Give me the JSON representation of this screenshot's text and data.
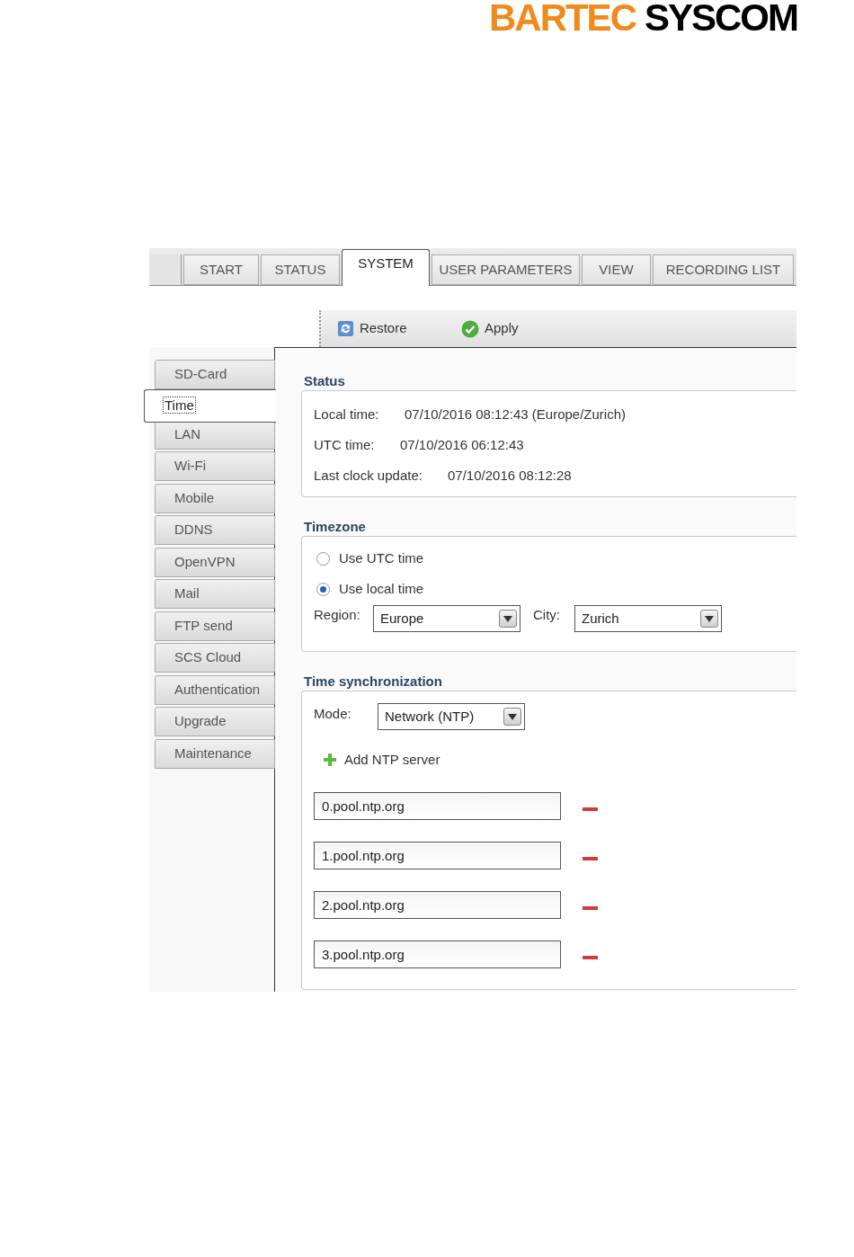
{
  "logo": {
    "brand": "BARTEC",
    "product": "SYSCOM"
  },
  "tabs": [
    {
      "label": "START",
      "selected": false
    },
    {
      "label": "STATUS",
      "selected": false
    },
    {
      "label": "SYSTEM",
      "selected": true
    },
    {
      "label": "USER PARAMETERS",
      "selected": false
    },
    {
      "label": "VIEW",
      "selected": false
    },
    {
      "label": "RECORDING LIST",
      "selected": false
    }
  ],
  "toolbar": [
    {
      "kind": "restore",
      "label": "Restore"
    },
    {
      "kind": "apply",
      "label": "Apply"
    }
  ],
  "sidebar": {
    "items": [
      {
        "label": "SD-Card",
        "selected": false
      },
      {
        "label": "Time",
        "selected": true
      },
      {
        "label": "LAN",
        "selected": false
      },
      {
        "label": "Wi-Fi",
        "selected": false
      },
      {
        "label": "Mobile",
        "selected": false
      },
      {
        "label": "DDNS",
        "selected": false
      },
      {
        "label": "OpenVPN",
        "selected": false
      },
      {
        "label": "Mail",
        "selected": false
      },
      {
        "label": "FTP send",
        "selected": false
      },
      {
        "label": "SCS Cloud",
        "selected": false
      },
      {
        "label": "Authentication",
        "selected": false
      },
      {
        "label": "Upgrade",
        "selected": false
      },
      {
        "label": "Maintenance",
        "selected": false
      }
    ]
  },
  "status": {
    "title": "Status",
    "rows": [
      {
        "label": "Local time:",
        "value": "07/10/2016 08:12:43 (Europe/Zurich)"
      },
      {
        "label": "UTC time:",
        "value": "07/10/2016 06:12:43"
      },
      {
        "label": "Last clock update:",
        "value": "07/10/2016 08:12:28"
      }
    ]
  },
  "timezone": {
    "title": "Timezone",
    "options": [
      {
        "label": "Use UTC time",
        "selected": false
      },
      {
        "label": "Use local time",
        "selected": true
      }
    ],
    "region": {
      "label": "Region:",
      "value": "Europe"
    },
    "city": {
      "label": "City:",
      "value": "Zurich"
    }
  },
  "sync": {
    "title": "Time synchronization",
    "mode": {
      "label": "Mode:",
      "value": "Network (NTP)"
    },
    "add_button": "Add NTP server",
    "servers": [
      "0.pool.ntp.org",
      "1.pool.ntp.org",
      "2.pool.ntp.org",
      "3.pool.ntp.org"
    ]
  }
}
